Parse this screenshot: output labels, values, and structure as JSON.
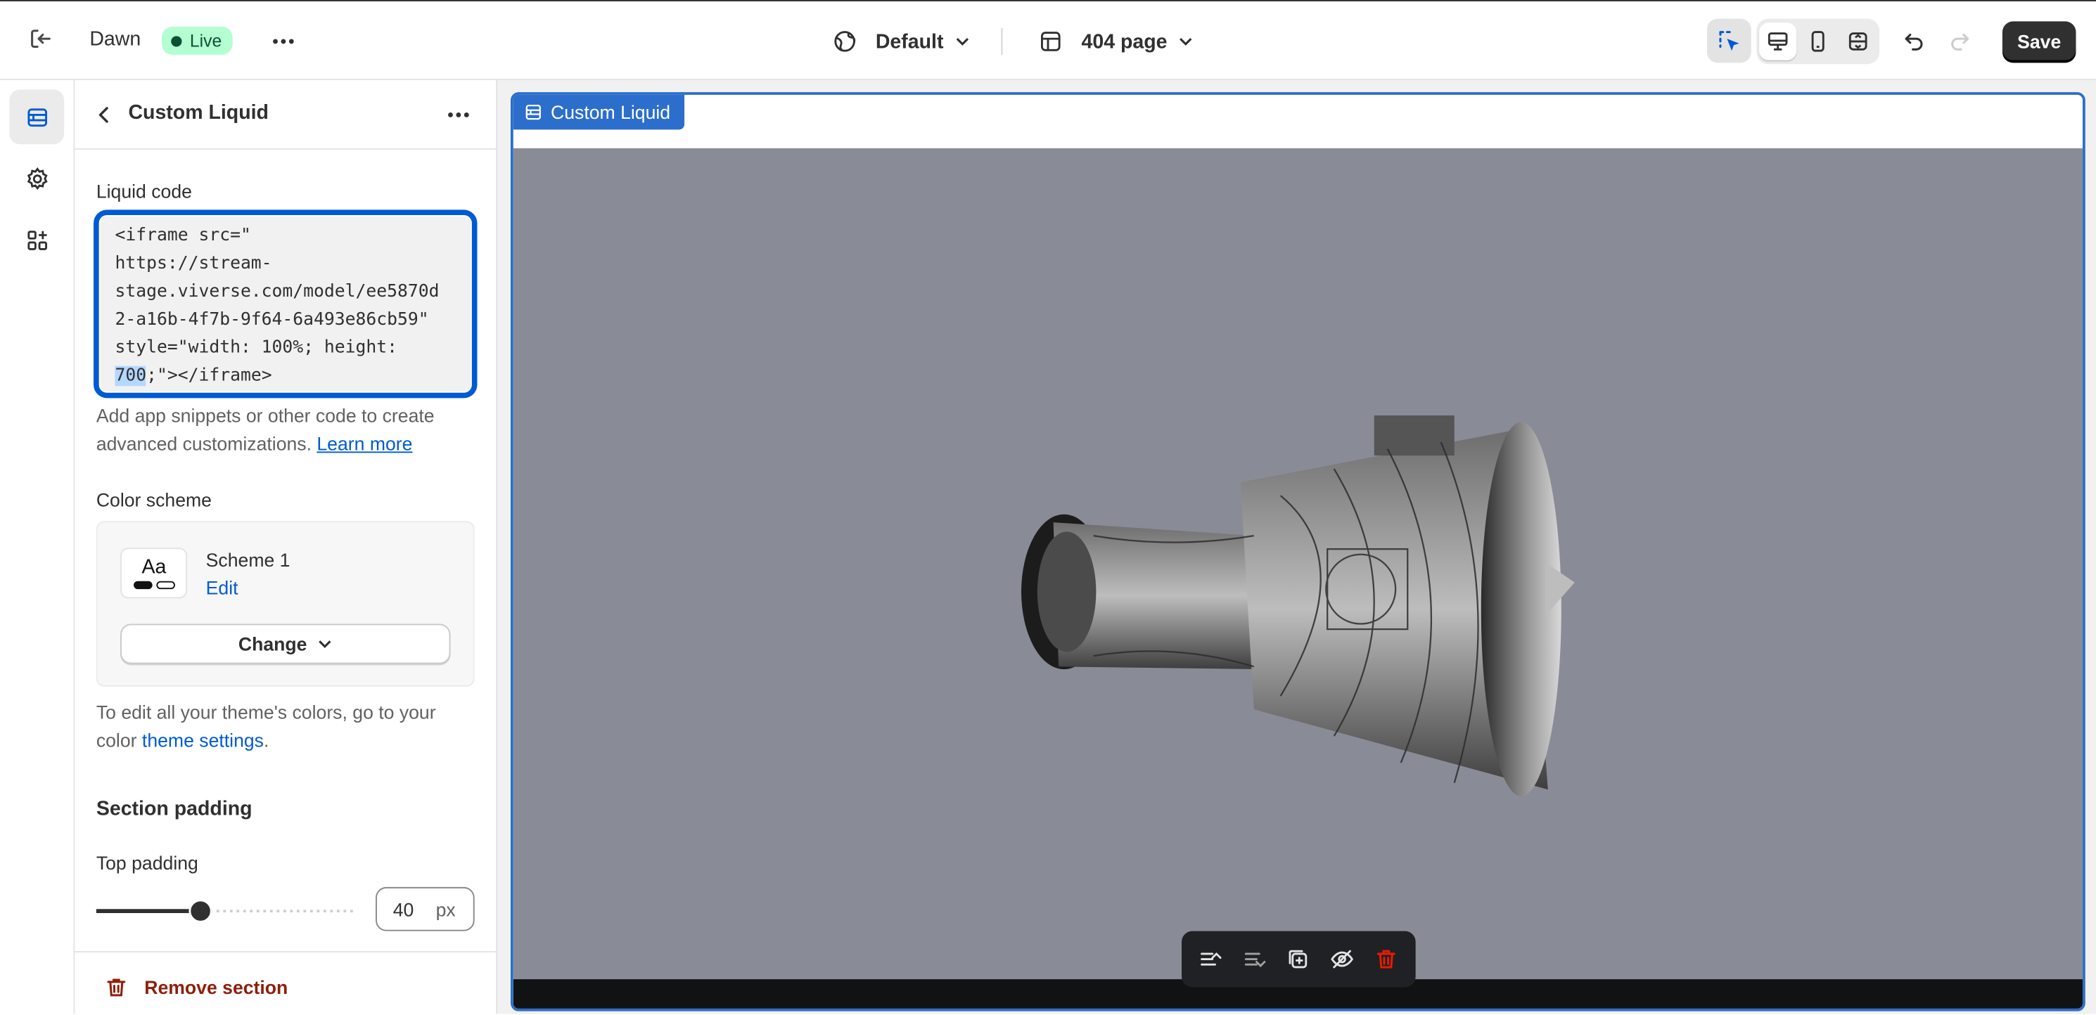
{
  "topbar": {
    "store_name": "Dawn",
    "status_badge": "Live",
    "theme_picker": "Default",
    "template_picker": "404 page",
    "save_label": "Save"
  },
  "panel": {
    "title": "Custom Liquid",
    "liquid_code_label": "Liquid code",
    "liquid_code_lines": [
      "<iframe src=\"",
      "https://stream-",
      "stage.viverse.com/model/ee5870d",
      "2-a16b-4f7b-9f64-6a493e86cb59\"",
      "style=\"width: 100%; height:",
      "700;\"></iframe>"
    ],
    "liquid_code_selected": "700",
    "liquid_code_after_selected": ";\"></iframe>",
    "help_text": "Add app snippets or other code to create advanced customizations.",
    "help_link": "Learn more",
    "color_scheme_label": "Color scheme",
    "scheme_swatch_text": "Aa",
    "scheme_name": "Scheme 1",
    "scheme_edit": "Edit",
    "change_button": "Change",
    "theme_note_prefix": "To edit all your theme's colors, go to your color",
    "theme_note_link": "theme settings",
    "theme_note_suffix": ".",
    "section_padding_heading": "Section padding",
    "top_padding_label": "Top padding",
    "top_padding_value": "40",
    "top_padding_unit": "px",
    "top_padding_fraction": 0.4,
    "remove_section": "Remove section"
  },
  "preview": {
    "section_tag": "Custom Liquid"
  },
  "colors": {
    "accent": "#005bd3",
    "frame_outline": "#2c6ecb",
    "live_badge_bg": "#b4fed2",
    "viewer_bg": "#898c97",
    "danger": "#8e1f0b"
  }
}
